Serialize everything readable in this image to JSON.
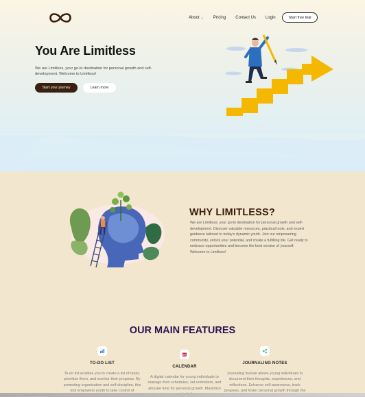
{
  "nav": {
    "items": [
      {
        "label": "About",
        "has_dropdown": true
      },
      {
        "label": "Pricing",
        "has_dropdown": false
      },
      {
        "label": "Contact Us",
        "has_dropdown": false
      },
      {
        "label": "Login",
        "has_dropdown": false
      }
    ],
    "cta_label": "Start free trial"
  },
  "logo": {
    "icon": "infinity-icon",
    "color": "#3a1c0b"
  },
  "hero": {
    "title": "You Are Limitless",
    "subtitle": "We are Limitless, your go-to destination for personal growth and self-development. Welcome to Limitless!",
    "primary_button": "Start your journey",
    "secondary_button": "Learn more"
  },
  "why": {
    "title": "WHY LIMITLESS?",
    "text": "We are Limitless, your go-to destination for personal growth and self-development. Discover valuable resources, practical tools, and expert guidance tailored to today's dynamic youth. Join our empowering community, unlock your potential, and create a fulfilling life. Get ready to embrace opportunities and become the best version of yourself. Welcome to Limitless!"
  },
  "features": {
    "title": "OUR MAIN FEATURES",
    "items": [
      {
        "icon": "chart-icon",
        "name": "TO-DO LIST",
        "description": "To-do list enables you to create a list of tasks, prioritize them, and monitor their progress. By promoting organization and self-discipline, this tool empowers youth to take control of"
      },
      {
        "icon": "calendar-icon",
        "name": "CALENDAR",
        "description": "A digital calendar for young individuals to manage their schedules, set reminders, and allocate time for personal growth. Maximize productivity"
      },
      {
        "icon": "journal-icon",
        "name": "JOURNALING NOTES",
        "description": "Journaling feature allows young individuals to document their thoughts, experiences, and reflections. Enhance self-awareness, track progress, and foster personal growth through the"
      }
    ]
  },
  "colors": {
    "accent_dark": "#3a200f",
    "heading_brown": "#3a1d0c",
    "features_heading": "#2a1550",
    "background": "#f2e6cf",
    "stairs_yellow": "#f5b800"
  }
}
